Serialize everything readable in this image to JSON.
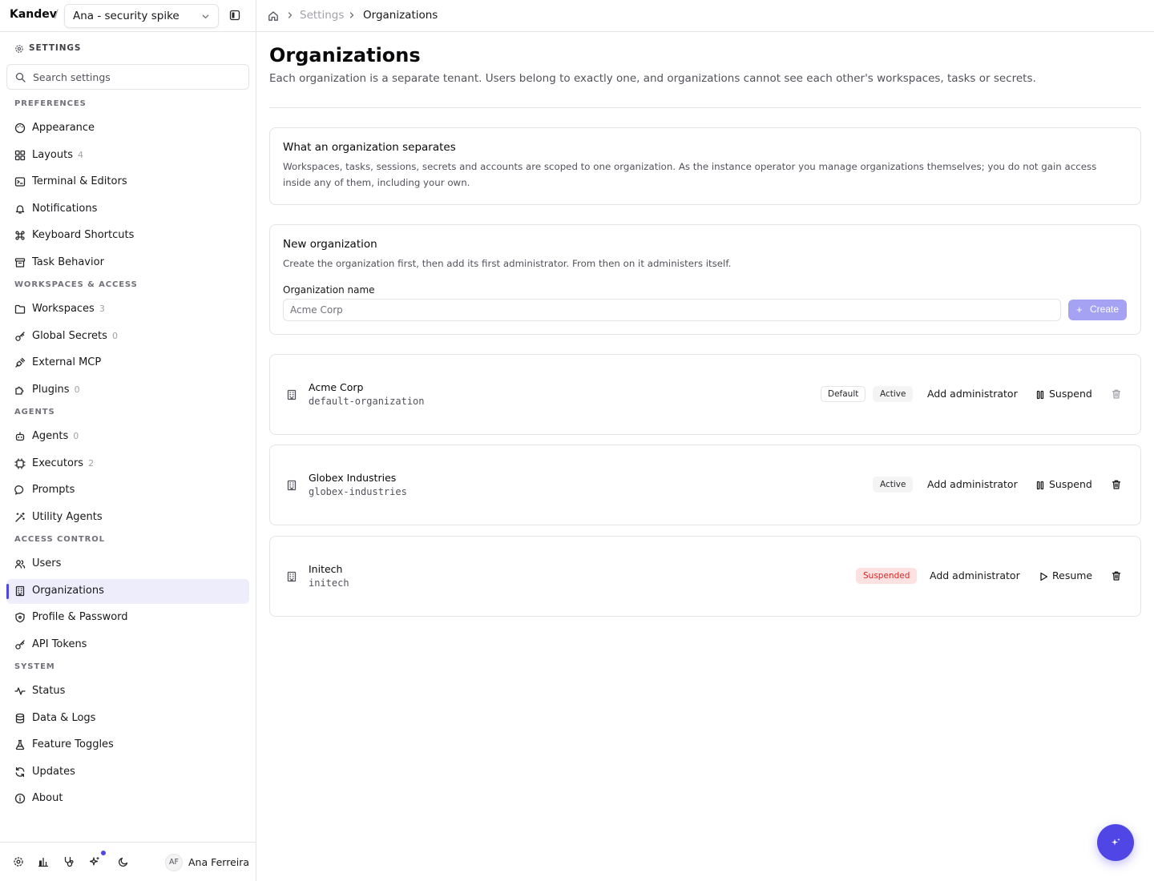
{
  "app": {
    "brand": "Kandev",
    "separator": "/",
    "workspace_selector": "Ana - security spike"
  },
  "sidebar": {
    "settings_label": "SETTINGS",
    "search_placeholder": "Search settings",
    "groups": [
      {
        "title": "PREFERENCES",
        "items": [
          {
            "label": "Appearance",
            "icon": "palette-icon"
          },
          {
            "label": "Layouts",
            "count": "4",
            "icon": "layout-grid-icon"
          },
          {
            "label": "Terminal & Editors",
            "icon": "terminal-icon"
          },
          {
            "label": "Notifications",
            "icon": "bell-icon"
          },
          {
            "label": "Keyboard Shortcuts",
            "icon": "command-icon"
          },
          {
            "label": "Task Behavior",
            "icon": "archive-icon"
          }
        ]
      },
      {
        "title": "WORKSPACES & ACCESS",
        "items": [
          {
            "label": "Workspaces",
            "count": "3",
            "icon": "folder-icon"
          },
          {
            "label": "Global Secrets",
            "count": "0",
            "icon": "key-icon"
          },
          {
            "label": "External MCP",
            "icon": "plug-icon"
          },
          {
            "label": "Plugins",
            "count": "0",
            "icon": "puzzle-icon"
          }
        ]
      },
      {
        "title": "AGENTS",
        "items": [
          {
            "label": "Agents",
            "count": "0",
            "icon": "bot-icon"
          },
          {
            "label": "Executors",
            "count": "2",
            "icon": "cpu-icon"
          },
          {
            "label": "Prompts",
            "icon": "message-icon"
          },
          {
            "label": "Utility Agents",
            "icon": "wand-icon"
          }
        ]
      },
      {
        "title": "ACCESS CONTROL",
        "items": [
          {
            "label": "Users",
            "icon": "users-icon"
          },
          {
            "label": "Organizations",
            "icon": "building-icon",
            "active": true
          },
          {
            "label": "Profile & Password",
            "icon": "shield-icon"
          },
          {
            "label": "API Tokens",
            "icon": "key-icon"
          }
        ]
      },
      {
        "title": "SYSTEM",
        "items": [
          {
            "label": "Status",
            "icon": "activity-icon"
          },
          {
            "label": "Data & Logs",
            "icon": "database-icon"
          },
          {
            "label": "Feature Toggles",
            "icon": "flask-icon"
          },
          {
            "label": "Updates",
            "icon": "refresh-icon"
          },
          {
            "label": "About",
            "icon": "info-icon"
          }
        ]
      }
    ],
    "footer": {
      "avatar_initials": "AF",
      "user_name": "Ana Ferreira"
    }
  },
  "breadcrumb": {
    "settings": "Settings",
    "current": "Organizations"
  },
  "page": {
    "title": "Organizations",
    "description": "Each organization is a separate tenant. Users belong to exactly one, and organizations cannot see each other's workspaces, tasks or secrets."
  },
  "info_card": {
    "title": "What an organization separates",
    "text": "Workspaces, tasks, sessions, secrets and accounts are scoped to one organization. As the instance operator you manage organizations themselves; you do not gain access inside any of them, including your own."
  },
  "new_org": {
    "title": "New organization",
    "text": "Create the organization first, then add its first administrator. From then on it administers itself.",
    "field_label": "Organization name",
    "placeholder": "Acme Corp",
    "value": "",
    "create_label": "Create"
  },
  "organizations": [
    {
      "name": "Acme Corp",
      "slug": "default-organization",
      "default_badge": "Default",
      "status": "Active",
      "add_admin": "Add administrator",
      "action": "Suspend"
    },
    {
      "name": "Globex Industries",
      "slug": "globex-industries",
      "status": "Active",
      "add_admin": "Add administrator",
      "action": "Suspend"
    },
    {
      "name": "Initech",
      "slug": "initech",
      "status": "Suspended",
      "add_admin": "Add administrator",
      "action": "Resume"
    }
  ],
  "colors": {
    "accent": "#4f46e5",
    "accent_soft": "#ededfb",
    "create_button": "#a5a2f3",
    "suspended_text": "#dc2626",
    "suspended_bg": "#fee2e2"
  }
}
